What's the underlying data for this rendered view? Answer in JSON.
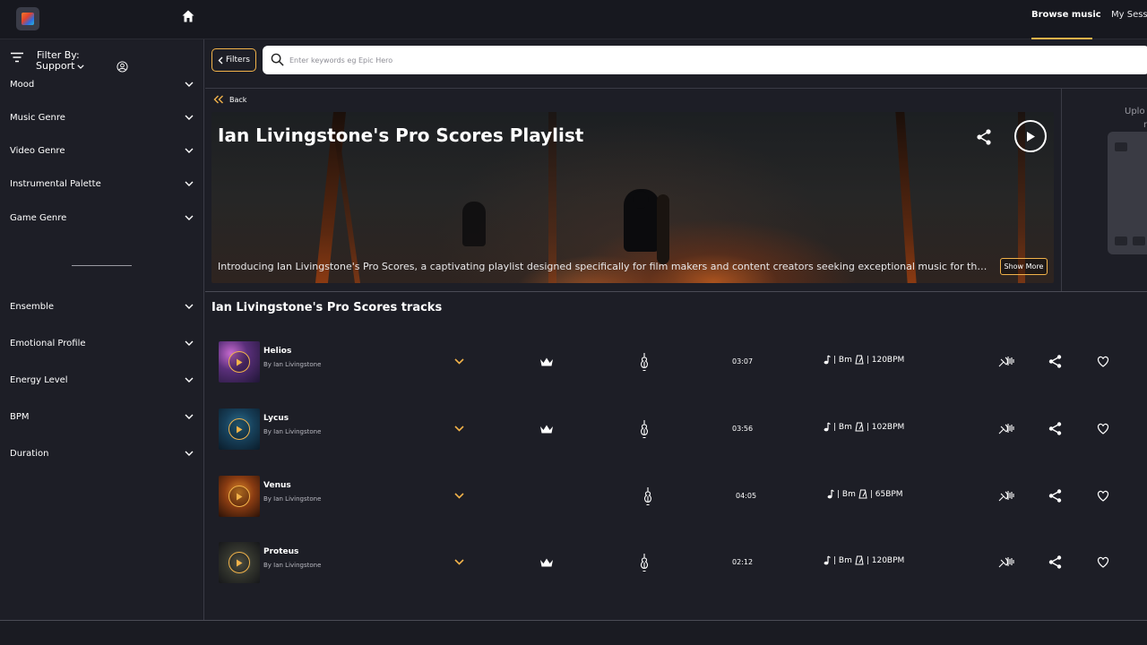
{
  "topbar": {
    "nav_tabs": [
      {
        "label": "Browse music",
        "active": true
      },
      {
        "label": "My Sess",
        "active": false
      }
    ],
    "accent_color": "#f2b34a"
  },
  "sidebar": {
    "filter_by_label": "Filter By:",
    "filter_scope": "Support",
    "filters_group1": [
      "Mood",
      "Music Genre",
      "Video Genre",
      "Instrumental Palette",
      "Game Genre"
    ],
    "filters_group2": [
      "Ensemble",
      "Emotional Profile",
      "Energy Level",
      "BPM",
      "Duration"
    ]
  },
  "toolbar": {
    "filters_label": "Filters",
    "search_placeholder": "Enter keywords eg Epic Hero"
  },
  "playlist": {
    "back_label": "Back",
    "title": "Ian Livingstone's Pro Scores Playlist",
    "description": "Introducing Ian Livingstone's Pro Scores, a captivating playlist designed specifically for film makers and content creators seeking exceptional music for their video projects.",
    "show_more_label": "Show More",
    "tracks_heading": "Ian Livingstone's Pro Scores tracks"
  },
  "upload_panel": {
    "line1": "Uplo",
    "line2": "r"
  },
  "tracks": [
    {
      "name": "Helios",
      "artist": "By Ian Livingstone",
      "premium": true,
      "duration": "03:07",
      "key": "| Bm",
      "tempo": "| 120BPM"
    },
    {
      "name": "Lycus",
      "artist": "By Ian Livingstone",
      "premium": true,
      "duration": "03:56",
      "key": "| Bm",
      "tempo": "| 102BPM"
    },
    {
      "name": "Venus",
      "artist": "By Ian Livingstone",
      "premium": false,
      "duration": "04:05",
      "key": "| Bm",
      "tempo": "| 65BPM"
    },
    {
      "name": "Proteus",
      "artist": "By Ian Livingstone",
      "premium": true,
      "duration": "02:12",
      "key": "| Bm",
      "tempo": "| 120BPM"
    }
  ],
  "icons": {
    "home": "home-icon",
    "filter": "filter-lines-icon",
    "user": "user-circle-icon",
    "search": "search-icon",
    "share": "share-icon",
    "play": "play-icon",
    "crown": "crown-icon",
    "violin": "violin-icon",
    "note": "music-note-icon",
    "tempo": "metronome-icon",
    "stems": "stems-icon",
    "heart": "heart-icon"
  }
}
